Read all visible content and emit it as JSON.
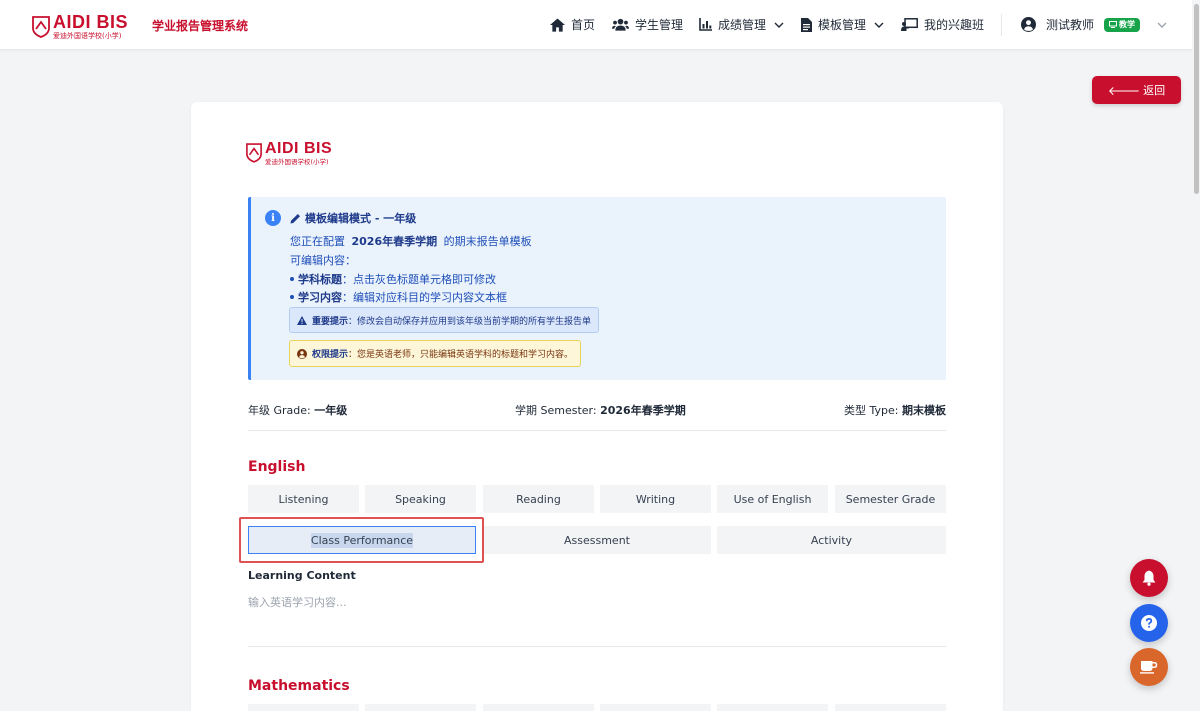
{
  "brand": {
    "logo_text": "AIDI BIS",
    "logo_subtext": "爱迪外国语学校(小学)",
    "system_title": "学业报告管理系统",
    "color": "#c8102e"
  },
  "nav": {
    "home": "首页",
    "students": "学生管理",
    "grades": "成绩管理",
    "templates": "模板管理",
    "interest_class": "我的兴趣班",
    "user_name": "测试教师",
    "role_badge": "教学"
  },
  "back_button": "返回",
  "notice": {
    "title": "模板编辑模式 - 一年级",
    "config_prefix": "您正在配置",
    "config_semester": "2026年春季学期",
    "config_suffix": "的期末报告单模板",
    "editable_heading": "可编辑内容：",
    "bullets": [
      {
        "label": "学科标题",
        "text": "：点击灰色标题单元格即可修改"
      },
      {
        "label": "学习内容",
        "text": "：编辑对应科目的学习内容文本框"
      }
    ],
    "important_label": "重要提示",
    "important_text": "：修改会自动保存并应用到该年级当前学期的所有学生报告单",
    "permission_label": "权限提示",
    "permission_text": "：您是英语老师，只能编辑英语学科的标题和学习内容。"
  },
  "meta": {
    "grade_label": "年级 Grade:",
    "grade_value": "一年级",
    "semester_label": "学期 Semester:",
    "semester_value": "2026年春季学期",
    "type_label": "类型 Type:",
    "type_value": "期末模板"
  },
  "english": {
    "title": "English",
    "row1": [
      "Listening",
      "Speaking",
      "Reading",
      "Writing",
      "Use of English",
      "Semester Grade"
    ],
    "row2": [
      "Class Performance",
      "Assessment",
      "Activity"
    ],
    "learning_label": "Learning Content",
    "learning_placeholder": "输入英语学习内容..."
  },
  "math": {
    "title": "Mathematics"
  },
  "fab_colors": {
    "bell": "#c8102e",
    "help": "#2563eb",
    "coffee": "#d9662a"
  }
}
